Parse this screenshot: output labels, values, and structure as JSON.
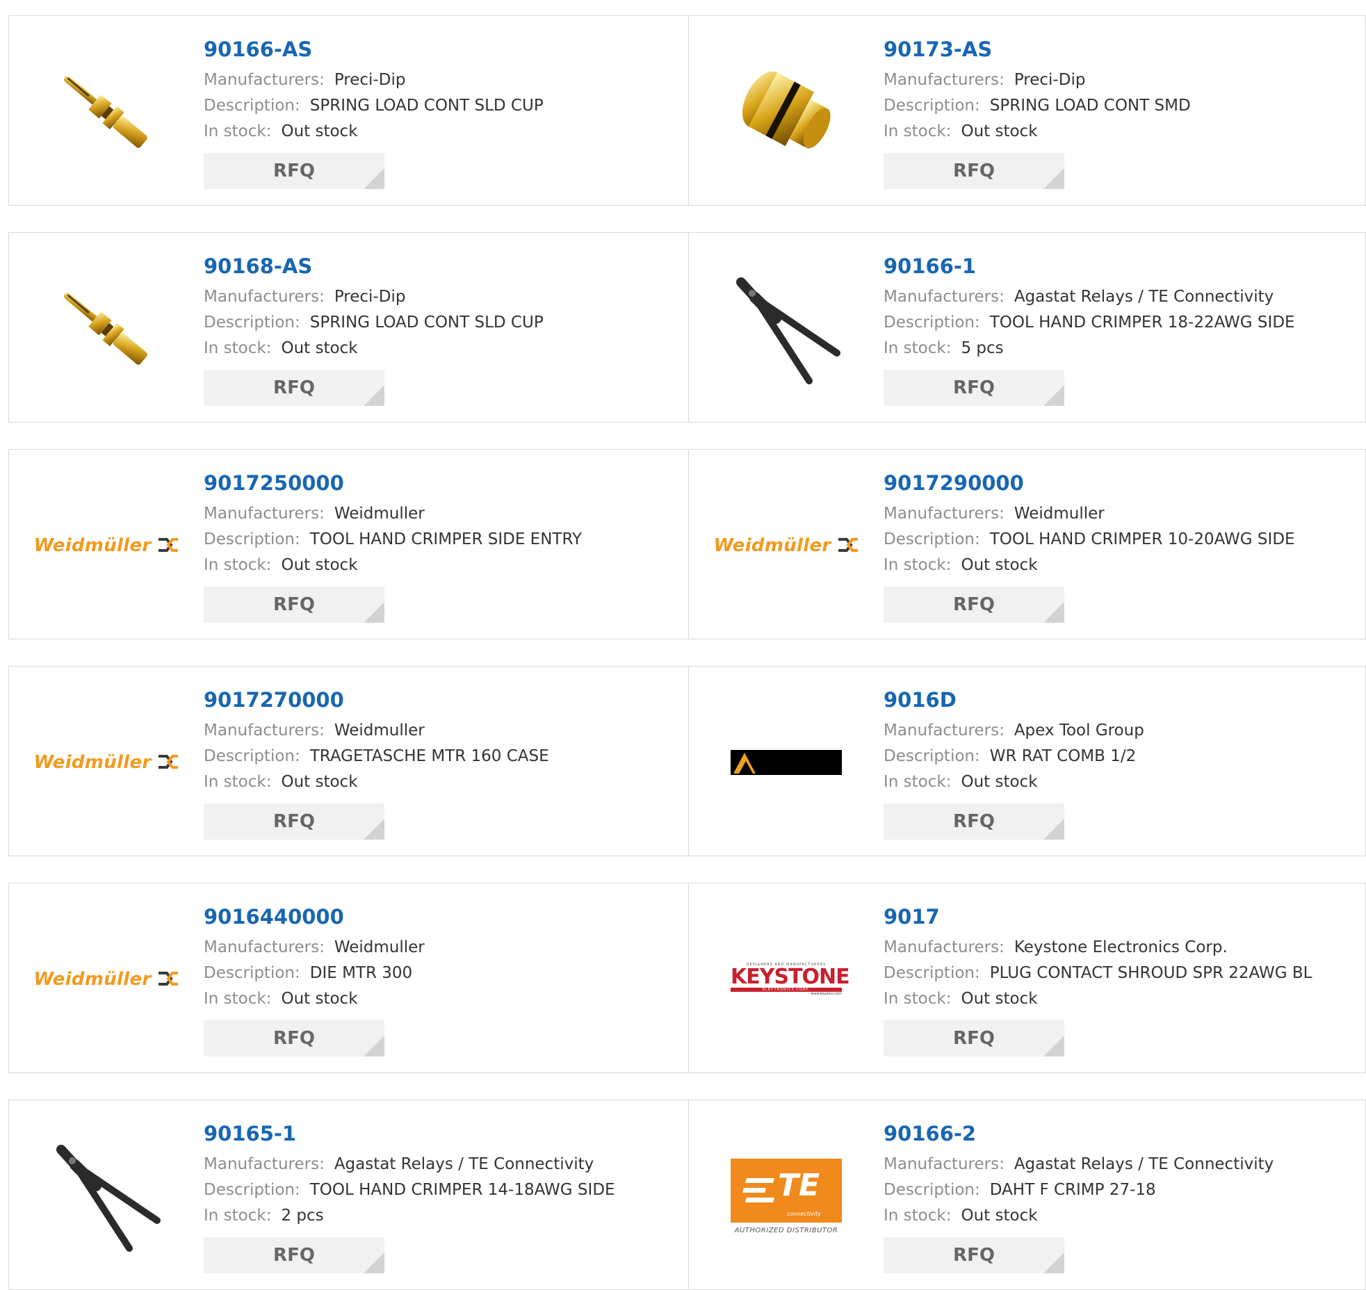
{
  "labels": {
    "manufacturers": "Manufacturers:",
    "description": "Description:",
    "stock": "In stock:",
    "rfq": "RFQ"
  },
  "products": [
    {
      "part": "90166-AS",
      "manufacturer": "Preci-Dip",
      "description": "SPRING LOAD CONT SLD CUP",
      "stock": "Out stock",
      "image": "pin-image"
    },
    {
      "part": "90173-AS",
      "manufacturer": "Preci-Dip",
      "description": "SPRING LOAD CONT SMD",
      "stock": "Out stock",
      "image": "smd-contact-image"
    },
    {
      "part": "90168-AS",
      "manufacturer": "Preci-Dip",
      "description": "SPRING LOAD CONT SLD CUP",
      "stock": "Out stock",
      "image": "pin-image"
    },
    {
      "part": "90166-1",
      "manufacturer": "Agastat Relays / TE Connectivity",
      "description": "TOOL HAND CRIMPER 18-22AWG SIDE",
      "stock": "5 pcs",
      "image": "crimper-image"
    },
    {
      "part": "9017250000",
      "manufacturer": "Weidmuller",
      "description": "TOOL HAND CRIMPER SIDE ENTRY",
      "stock": "Out stock",
      "image": "weidmuller-logo"
    },
    {
      "part": "9017290000",
      "manufacturer": "Weidmuller",
      "description": "TOOL HAND CRIMPER 10-20AWG SIDE",
      "stock": "Out stock",
      "image": "weidmuller-logo"
    },
    {
      "part": "9017270000",
      "manufacturer": "Weidmuller",
      "description": "TRAGETASCHE MTR 160 CASE",
      "stock": "Out stock",
      "image": "weidmuller-logo"
    },
    {
      "part": "9016D",
      "manufacturer": "Apex Tool Group",
      "description": "WR RAT COMB 1/2",
      "stock": "Out stock",
      "image": "apex-logo"
    },
    {
      "part": "9016440000",
      "manufacturer": "Weidmuller",
      "description": "DIE MTR 300",
      "stock": "Out stock",
      "image": "weidmuller-logo"
    },
    {
      "part": "9017",
      "manufacturer": "Keystone Electronics Corp.",
      "description": "PLUG CONTACT SHROUD SPR 22AWG BL",
      "stock": "Out stock",
      "image": "keystone-logo"
    },
    {
      "part": "90165-1",
      "manufacturer": "Agastat Relays / TE Connectivity",
      "description": "TOOL HAND CRIMPER 14-18AWG SIDE",
      "stock": "2 pcs",
      "image": "crimper-image"
    },
    {
      "part": "90166-2",
      "manufacturer": "Agastat Relays / TE Connectivity",
      "description": "DAHT F CRIMP 27-18",
      "stock": "Out stock",
      "image": "te-logo"
    }
  ],
  "logos": {
    "weidmuller": "Weidmüller",
    "keystone": "KEYSTONE",
    "keystone_top": "DESIGNERS AND MANUFACTURERS",
    "keystone_sub": "ELECTRONICS CORP.",
    "keystone_url": "www.keyelco.com",
    "te": "TE",
    "te_sub": "connectivity",
    "te_caption": "AUTHORIZED DISTRIBUTOR"
  },
  "colors": {
    "part_link": "#1866b3",
    "label": "#8d8d8d",
    "button_bg": "#f1f1f1",
    "weidmuller": "#f39a1e",
    "keystone": "#c8202f",
    "te": "#f08a1d"
  }
}
